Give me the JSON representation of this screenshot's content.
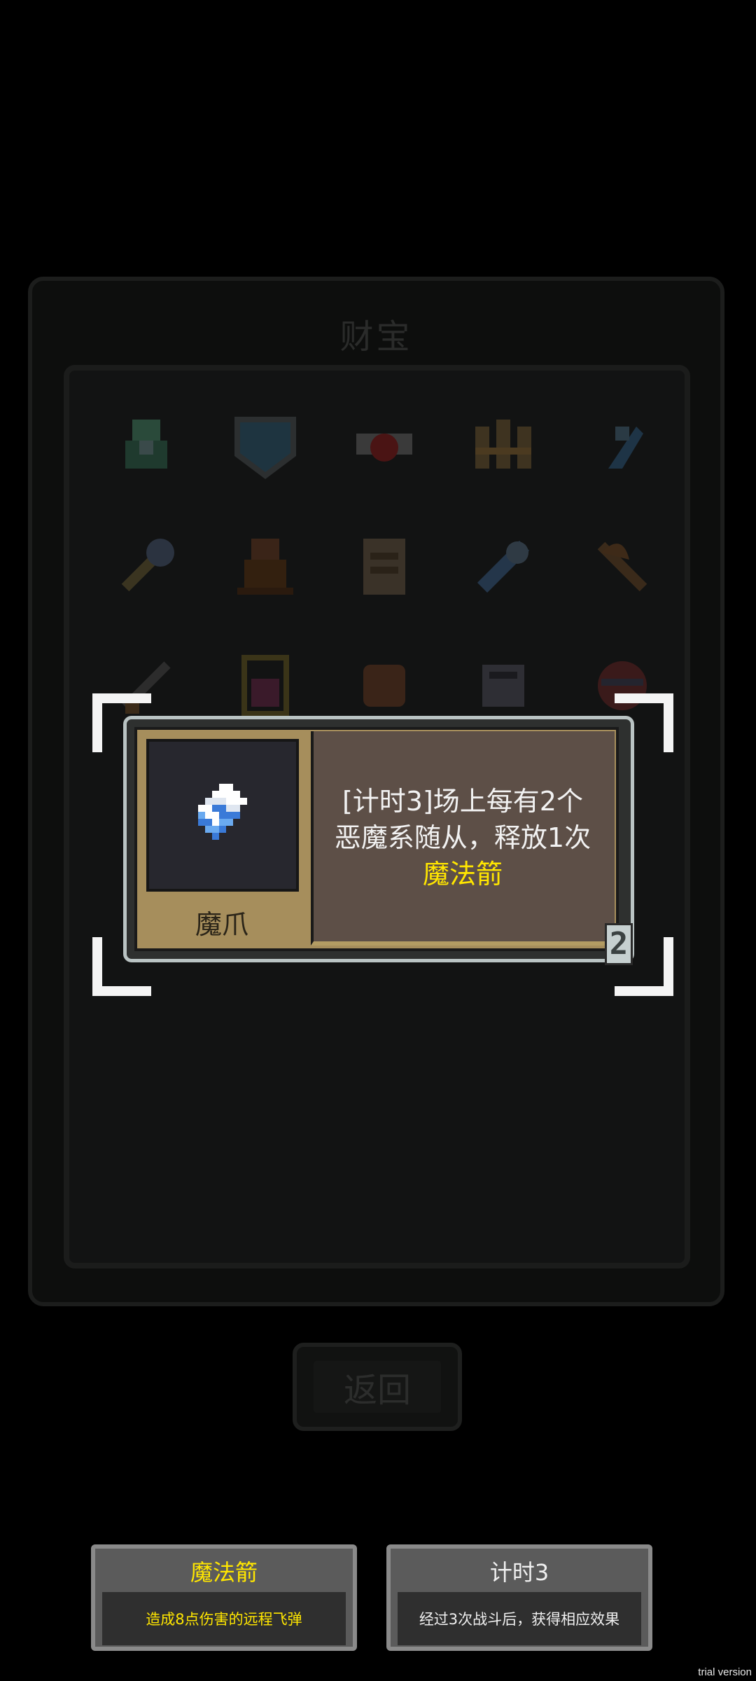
{
  "panel": {
    "title": "财宝"
  },
  "back_button": {
    "label": "返回"
  },
  "grid_items": [
    {
      "icon": "green-figure-icon"
    },
    {
      "icon": "shield-icon"
    },
    {
      "icon": "red-orb-icon"
    },
    {
      "icon": "golden-crown-icon"
    },
    {
      "icon": "blue-claw-icon"
    },
    {
      "icon": "gold-key-icon"
    },
    {
      "icon": "brown-statue-icon"
    },
    {
      "icon": "scroll-icon"
    },
    {
      "icon": "blue-sword-icon"
    },
    {
      "icon": "axe-icon"
    },
    {
      "icon": "dagger-icon"
    },
    {
      "icon": "potion-icon"
    },
    {
      "icon": "glove-icon"
    },
    {
      "icon": "white-glove-icon"
    },
    {
      "icon": "dark-orb-icon"
    }
  ],
  "popup": {
    "item_name": "魔爪",
    "item_icon": "demon-claw-icon",
    "description_line1": "[计时3]场上每有2个",
    "description_line2": "恶魔系随从，释放1次",
    "description_highlight": "魔法箭",
    "level": "2"
  },
  "tooltips": [
    {
      "title": "魔法箭",
      "body": "造成8点伤害的远程飞弹",
      "color": "#ffe600"
    },
    {
      "title": "计时3",
      "body": "经过3次战斗后，获得相应效果",
      "color": "#f0f0f0"
    }
  ],
  "watermark": "trial version"
}
